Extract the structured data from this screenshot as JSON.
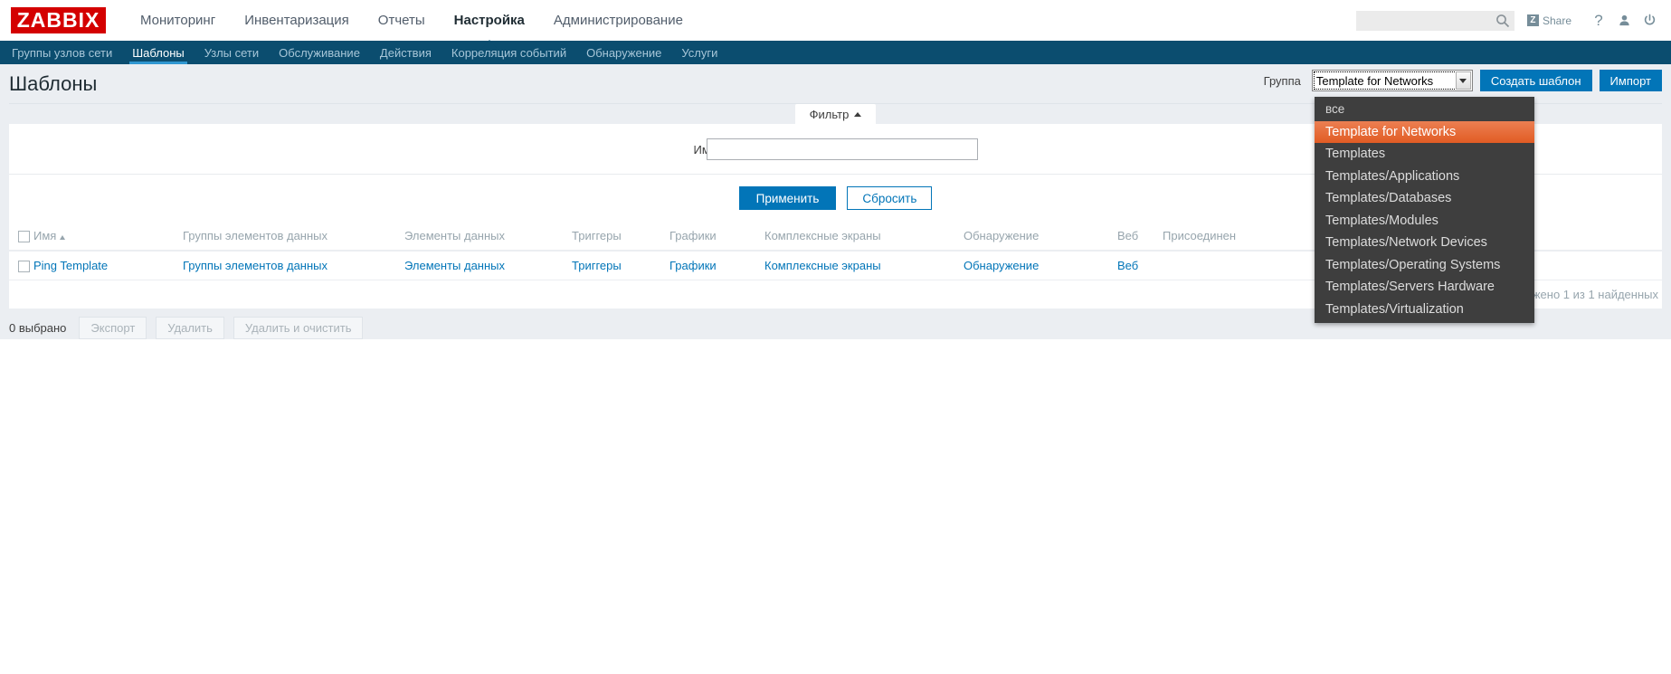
{
  "brand": {
    "logo_text": "ZABBIX",
    "logo_color": "#d40000"
  },
  "header": {
    "main_nav": [
      {
        "label": "Мониторинг",
        "selected": false
      },
      {
        "label": "Инвентаризация",
        "selected": false
      },
      {
        "label": "Отчеты",
        "selected": false
      },
      {
        "label": "Настройка",
        "selected": true
      },
      {
        "label": "Администрирование",
        "selected": false
      }
    ],
    "search": {
      "value": "",
      "placeholder": ""
    },
    "share_label": "Share",
    "share_badge": "Z",
    "icons": [
      "search-icon",
      "share-icon",
      "help-icon",
      "user-icon",
      "power-icon"
    ],
    "help_glyph": "?"
  },
  "subnav": {
    "items": [
      {
        "label": "Группы узлов сети",
        "selected": false
      },
      {
        "label": "Шаблоны",
        "selected": true
      },
      {
        "label": "Узлы сети",
        "selected": false
      },
      {
        "label": "Обслуживание",
        "selected": false
      },
      {
        "label": "Действия",
        "selected": false
      },
      {
        "label": "Корреляция событий",
        "selected": false
      },
      {
        "label": "Обнаружение",
        "selected": false
      },
      {
        "label": "Услуги",
        "selected": false
      }
    ]
  },
  "page": {
    "title": "Шаблоны",
    "group_label": "Группа",
    "group_selected": "Template for Networks",
    "create_button": "Создать шаблон",
    "import_button": "Импорт"
  },
  "group_dropdown": {
    "open": true,
    "highlight_color": "#e15c24",
    "background_color": "#3e3e3e",
    "options": [
      "все",
      "Template for Networks",
      "Templates",
      "Templates/Applications",
      "Templates/Databases",
      "Templates/Modules",
      "Templates/Network Devices",
      "Templates/Operating Systems",
      "Templates/Servers Hardware",
      "Templates/Virtualization"
    ],
    "selected_index": 1
  },
  "filter": {
    "tab_label": "Фильтр",
    "name_label": "Имя",
    "name_value": "",
    "name_placeholder": "",
    "apply_button": "Применить",
    "reset_button": "Сбросить"
  },
  "table": {
    "columns": [
      "Имя",
      "Группы элементов данных",
      "Элементы данных",
      "Триггеры",
      "Графики",
      "Комплексные экраны",
      "Обнаружение",
      "Веб",
      "Присоединен",
      "Присоединен к"
    ],
    "sort_column": "Имя",
    "sort_direction": "asc",
    "rows": [
      {
        "name": "Ping Template",
        "item_groups": "Группы элементов данных",
        "items": "Элементы данных",
        "triggers": "Триггеры",
        "graphs": "Графики",
        "screens": "Комплексные экраны",
        "discovery": "Обнаружение",
        "web": "Веб",
        "linked": "",
        "linked_to": ""
      }
    ],
    "count_text": "Отображено 1 из 1 найденных"
  },
  "footer": {
    "selected_text": "0 выбрано",
    "actions": [
      "Экспорт",
      "Удалить",
      "Удалить и очистить"
    ]
  }
}
